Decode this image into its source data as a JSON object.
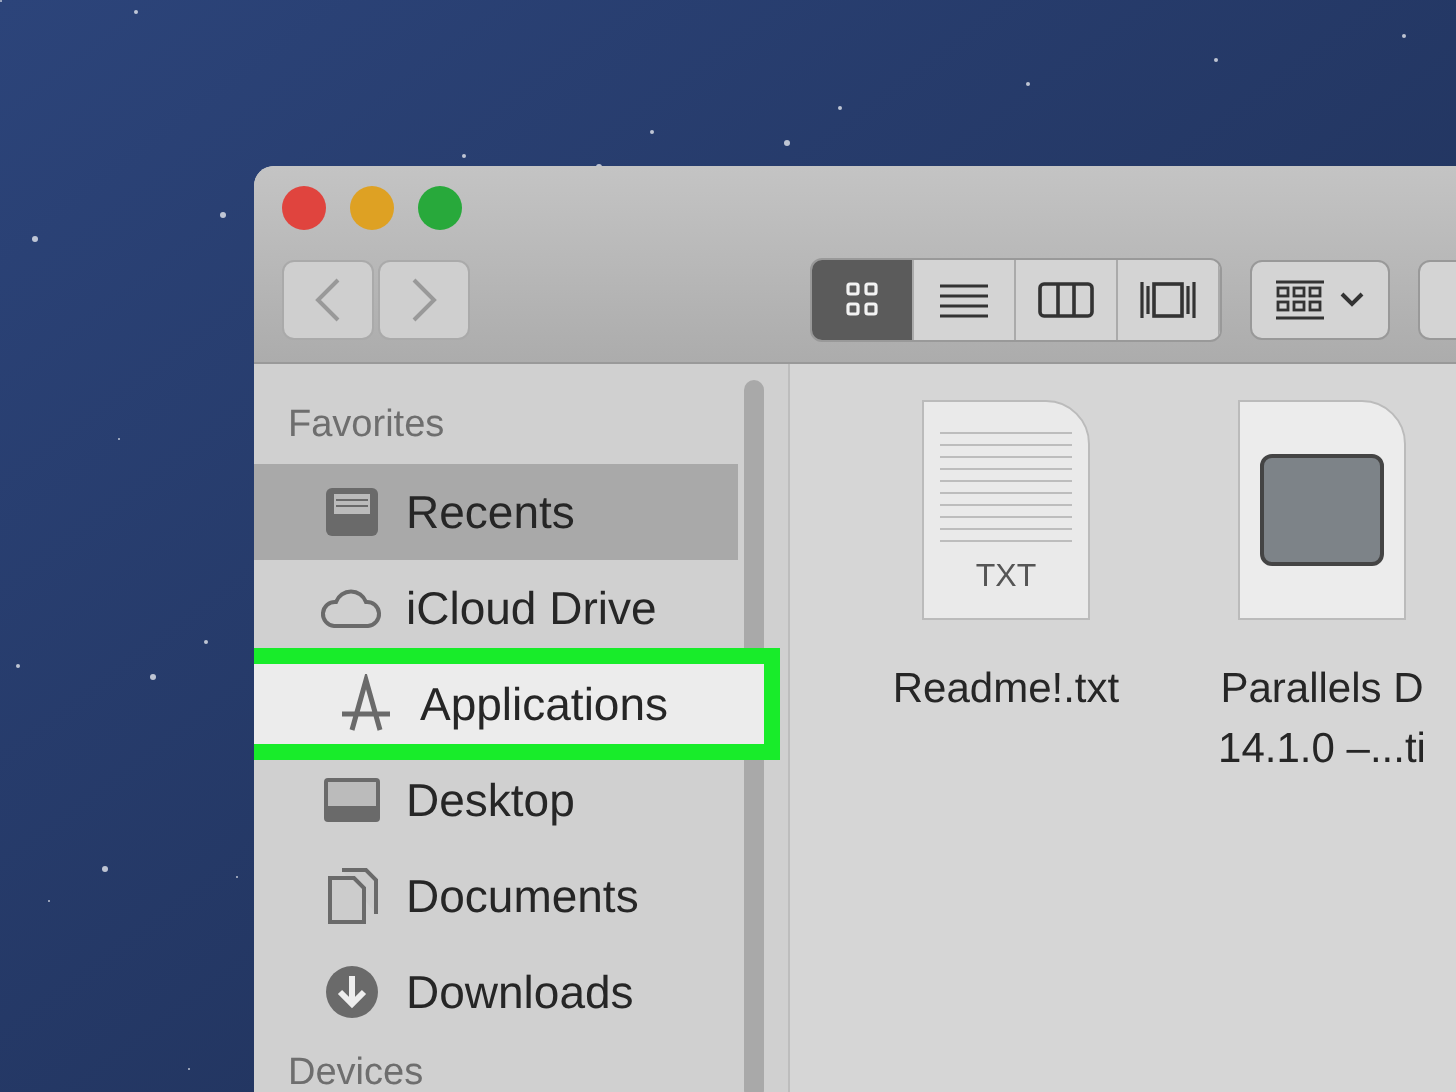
{
  "window": {
    "controls": [
      {
        "color": "#e0443e"
      },
      {
        "color": "#dea123"
      },
      {
        "color": "#28a93b"
      }
    ]
  },
  "toolbar": {
    "views": [
      {
        "kind": "icons",
        "selected": true
      },
      {
        "kind": "list",
        "selected": false
      },
      {
        "kind": "columns",
        "selected": false
      },
      {
        "kind": "gallery",
        "selected": false
      }
    ]
  },
  "sidebar": {
    "sections": [
      {
        "heading": "Favorites",
        "items": [
          {
            "label": "Recents",
            "kind": "tray",
            "selected": true,
            "callout": false
          },
          {
            "label": "iCloud Drive",
            "kind": "cloud",
            "selected": false,
            "callout": false
          },
          {
            "label": "Applications",
            "kind": "apps",
            "selected": false,
            "callout": true
          },
          {
            "label": "Desktop",
            "kind": "desktop",
            "selected": false,
            "callout": false
          },
          {
            "label": "Documents",
            "kind": "documents",
            "selected": false,
            "callout": false
          },
          {
            "label": "Downloads",
            "kind": "downloads",
            "selected": false,
            "callout": false
          }
        ]
      },
      {
        "heading": "Devices"
      }
    ]
  },
  "files": [
    {
      "kind": "text",
      "badge": "TXT",
      "name": [
        "Readme!.txt"
      ]
    },
    {
      "kind": "disk",
      "name": [
        "Parallels D",
        "14.1.0 –...ti"
      ]
    }
  ]
}
